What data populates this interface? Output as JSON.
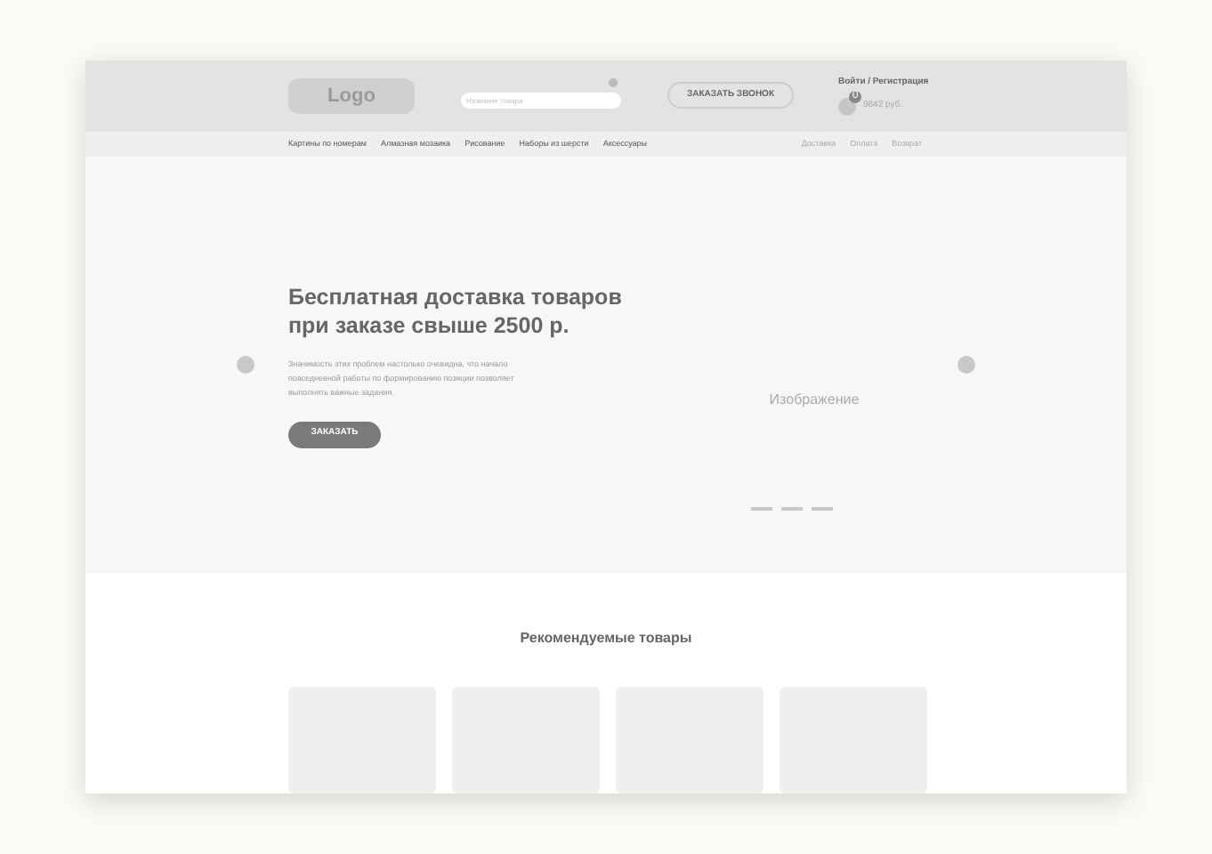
{
  "header": {
    "logo": "Logo",
    "search": {
      "placeholder": "Название товара"
    },
    "call_button": "ЗАКАЗАТЬ ЗВОНОК",
    "login": "Войти / Регистрация",
    "cart": {
      "count": "0",
      "total": "9842 руб."
    }
  },
  "nav": {
    "categories": [
      "Картины по номерам",
      "Алмазная мозаика",
      "Рисование",
      "Наборы из шерсти",
      "Аксессуары"
    ],
    "links": [
      "Доставка",
      "Оплата",
      "Возврат"
    ]
  },
  "hero": {
    "title": "Бесплатная доставка товаров при заказе свыше 2500 р.",
    "text": "Значимость этих проблем настолько очевидна, что начало повседневной работы по формированию позиции позволяет выполнять важные задания.",
    "button": "ЗАКАЗАТЬ",
    "image_label": "Изображение"
  },
  "recommended": {
    "title": "Рекомендуемые товары"
  }
}
